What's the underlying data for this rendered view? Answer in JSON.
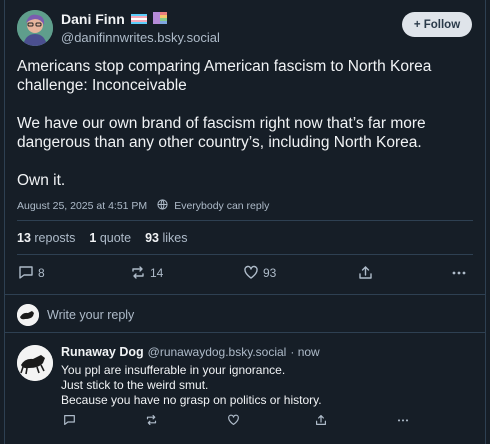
{
  "author": {
    "name": "Dani Finn",
    "handle": "@danifinnwrites.bsky.social",
    "avatar": "avatar-illustration"
  },
  "follow_label": "+ Follow",
  "post": {
    "line1": "Americans stop comparing American fascism to North Korea",
    "line2": "challenge: Inconceivable",
    "line3": "We have our own brand of fascism right now that’s far more",
    "line4": "dangerous than any other country’s, including North Korea.",
    "line5": "Own it.",
    "timestamp": "August 25, 2025 at 4:51 PM",
    "visibility": "Everybody can reply"
  },
  "stats": {
    "reposts_count": "13",
    "reposts_label": "reposts",
    "quotes_count": "1",
    "quotes_label": "quote",
    "likes_count": "93",
    "likes_label": "likes"
  },
  "actions": {
    "replies": "8",
    "reposts": "14",
    "likes": "93"
  },
  "compose": {
    "placeholder": "Write your reply"
  },
  "reply": {
    "name": "Runaway Dog",
    "handle": "@runawaydog.bsky.social",
    "time": "· now",
    "line1": "You ppl are insufferable in your ignorance.",
    "line2": "Just stick to the weird smut.",
    "line3": "Because you have no grasp on politics or history."
  },
  "colors": {
    "background": "#161e27",
    "border": "#2e4052",
    "muted_text": "#aebbc9",
    "follow_bg": "#dfe4ea"
  }
}
